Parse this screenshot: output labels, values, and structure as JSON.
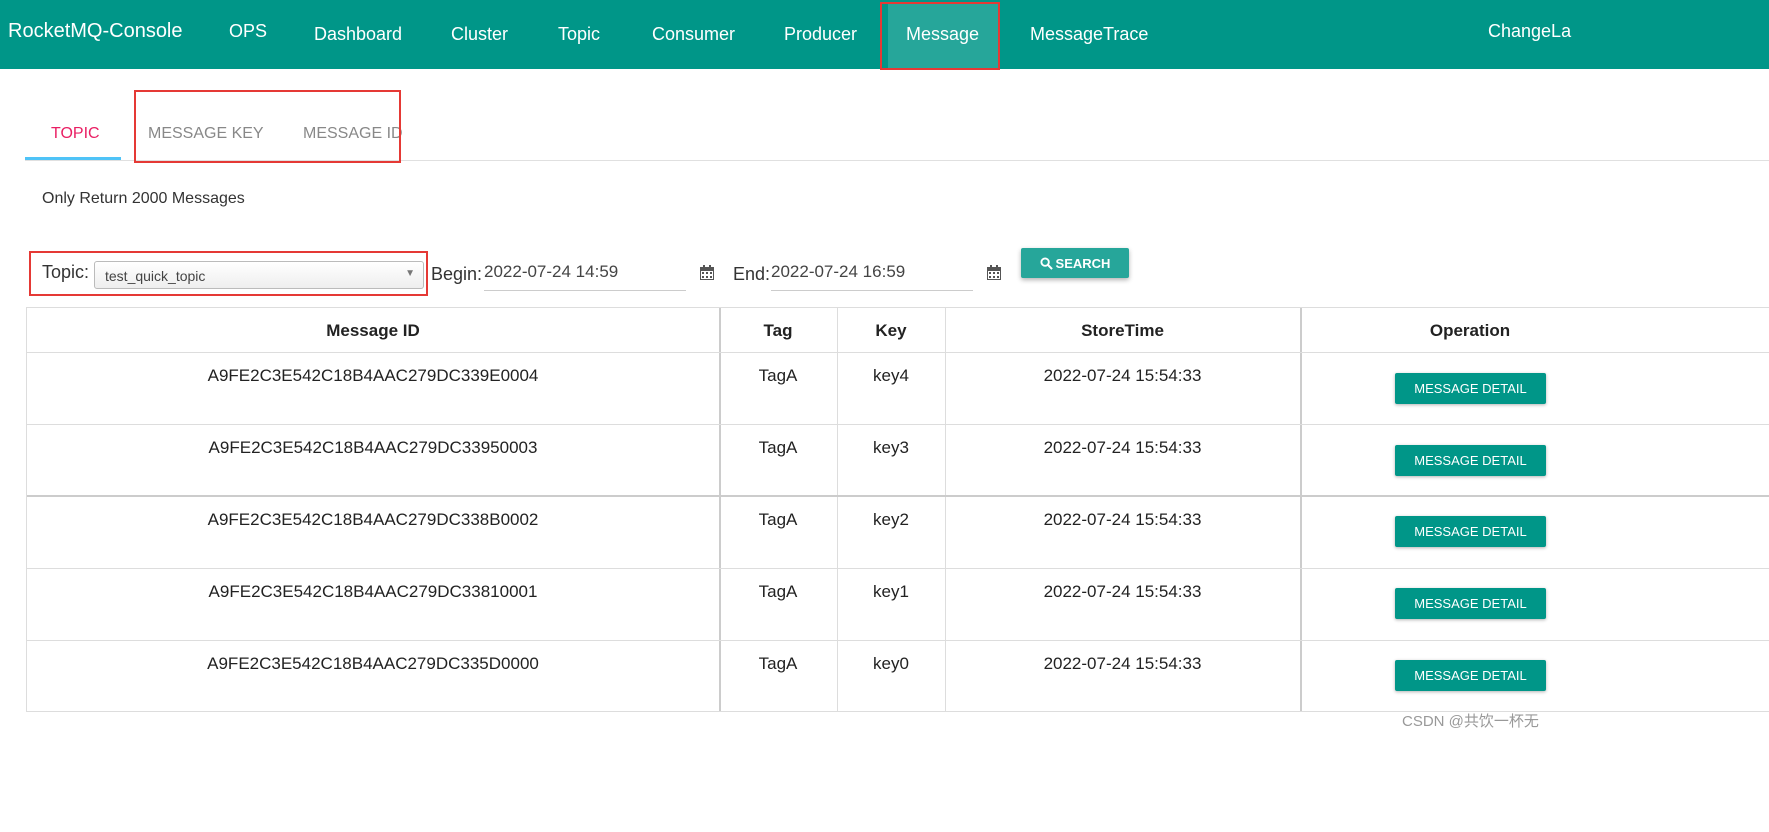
{
  "nav": {
    "brand": "RocketMQ-Console",
    "items": [
      "OPS",
      "Dashboard",
      "Cluster",
      "Topic",
      "Consumer",
      "Producer",
      "Message",
      "MessageTrace"
    ],
    "active": "Message",
    "right_label": "ChangeLa"
  },
  "tabs": [
    "TOPIC",
    "MESSAGE KEY",
    "MESSAGE ID"
  ],
  "active_tab": "TOPIC",
  "notice": "Only Return 2000 Messages",
  "filter": {
    "topic_label": "Topic:",
    "topic_value": "test_quick_topic",
    "begin_label": "Begin:",
    "begin_value": "2022-07-24 14:59",
    "end_label": "End:",
    "end_value": "2022-07-24 16:59",
    "search_label": "SEARCH"
  },
  "table": {
    "headers": [
      "Message ID",
      "Tag",
      "Key",
      "StoreTime",
      "Operation"
    ],
    "rows": [
      {
        "id": "A9FE2C3E542C18B4AAC279DC339E0004",
        "tag": "TagA",
        "key": "key4",
        "time": "2022-07-24 15:54:33",
        "op": "MESSAGE DETAIL"
      },
      {
        "id": "A9FE2C3E542C18B4AAC279DC33950003",
        "tag": "TagA",
        "key": "key3",
        "time": "2022-07-24 15:54:33",
        "op": "MESSAGE DETAIL"
      },
      {
        "id": "A9FE2C3E542C18B4AAC279DC338B0002",
        "tag": "TagA",
        "key": "key2",
        "time": "2022-07-24 15:54:33",
        "op": "MESSAGE DETAIL"
      },
      {
        "id": "A9FE2C3E542C18B4AAC279DC33810001",
        "tag": "TagA",
        "key": "key1",
        "time": "2022-07-24 15:54:33",
        "op": "MESSAGE DETAIL"
      },
      {
        "id": "A9FE2C3E542C18B4AAC279DC335D0000",
        "tag": "TagA",
        "key": "key0",
        "time": "2022-07-24 15:54:33",
        "op": "MESSAGE DETAIL"
      }
    ]
  },
  "watermark": "CSDN @共饮一杯无",
  "colors": {
    "nav": "#009688",
    "accent": "#e91e63",
    "highlight": "#e53935"
  }
}
